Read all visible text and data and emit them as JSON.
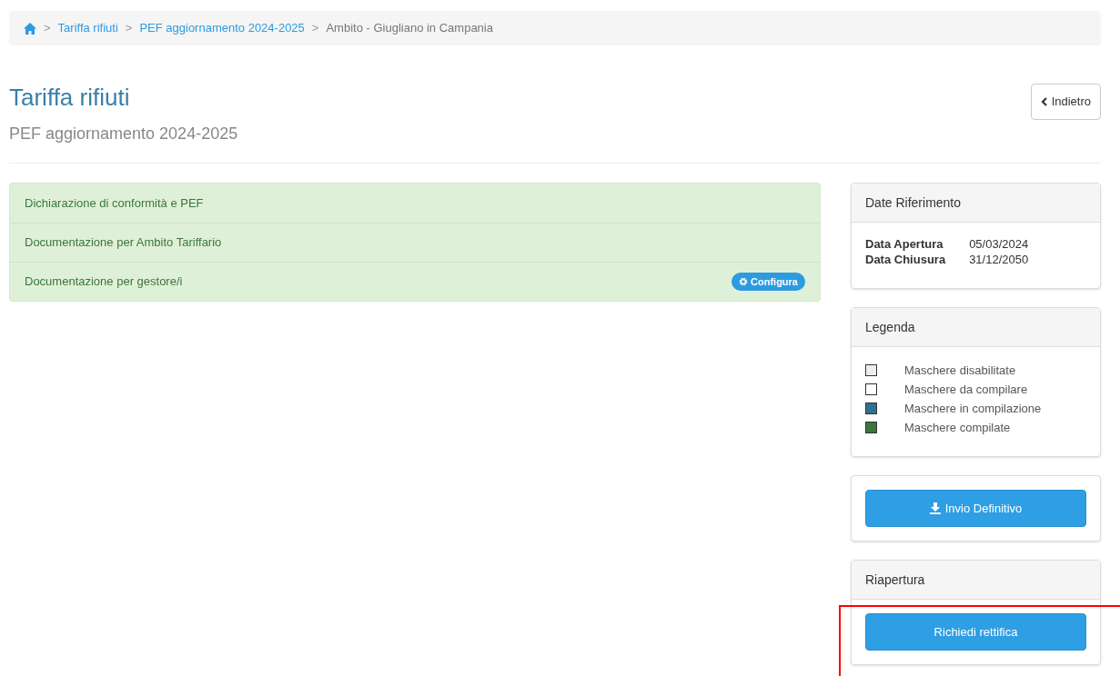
{
  "breadcrumb": [
    {
      "label": "Tariffa rifiuti",
      "kind": "link"
    },
    {
      "label": "PEF aggiornamento 2024-2025",
      "kind": "link"
    },
    {
      "label": "Ambito - Giugliano in Campania",
      "kind": "current"
    }
  ],
  "breadcrumb_separator": ">",
  "header": {
    "title": "Tariffa rifiuti",
    "subtitle": "PEF aggiornamento 2024-2025",
    "back_button": "Indietro"
  },
  "sections": [
    {
      "label": "Dichiarazione di conformità e PEF"
    },
    {
      "label": "Documentazione per Ambito Tariffario"
    },
    {
      "label": "Documentazione per gestore/i",
      "action": "Configura"
    }
  ],
  "dates_panel": {
    "title": "Date Riferimento",
    "rows": [
      {
        "label": "Data Apertura",
        "value": "05/03/2024"
      },
      {
        "label": "Data Chiusura",
        "value": "31/12/2050"
      }
    ]
  },
  "legend_panel": {
    "title": "Legenda",
    "items": [
      {
        "label": "Maschere disabilitate",
        "color": "#eeeeee"
      },
      {
        "label": "Maschere da compilare",
        "color": "#ffffff"
      },
      {
        "label": "Maschere in compilazione",
        "color": "#31708f"
      },
      {
        "label": "Maschere compilate",
        "color": "#3c763d"
      }
    ]
  },
  "submit_panel": {
    "button": "Invio Definitivo"
  },
  "reopen_panel": {
    "title": "Riapertura",
    "button": "Richiedi rettifica",
    "highlighted": true
  }
}
